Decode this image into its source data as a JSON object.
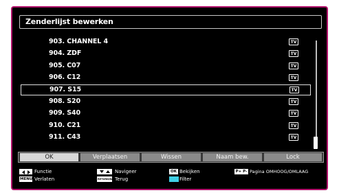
{
  "title": "Zenderlijst bewerken",
  "channels": [
    {
      "name": "903. CHANNEL 4",
      "type": "TV",
      "selected": false
    },
    {
      "name": "904. ZDF",
      "type": "TV",
      "selected": false
    },
    {
      "name": "905. C07",
      "type": "TV",
      "selected": false
    },
    {
      "name": "906. C12",
      "type": "TV",
      "selected": false
    },
    {
      "name": "907. S15",
      "type": "TV",
      "selected": true
    },
    {
      "name": "908. S20",
      "type": "TV",
      "selected": false
    },
    {
      "name": "909. S40",
      "type": "TV",
      "selected": false
    },
    {
      "name": "910. C21",
      "type": "TV",
      "selected": false
    },
    {
      "name": "911. C43",
      "type": "TV",
      "selected": false
    }
  ],
  "buttons": {
    "ok": "OK",
    "move": "Verplaatsen",
    "delete": "Wissen",
    "rename": "Naam bew.",
    "lock": "Lock"
  },
  "help": {
    "function_label": "Functie",
    "menu_key": "MENU",
    "exit_label": "Verlaten",
    "navigate_label": "Navigeer",
    "return_key": "RETURN/BACK",
    "back_label": "Terug",
    "ok_key": "OK",
    "view_label": "Bekijken",
    "filter_label": "Filter",
    "page_keys": "P+ P-",
    "page_label": "Pagina OMHOOG/OMLAAG"
  },
  "colors": {
    "frame_border": "#b0106a",
    "background": "#000000",
    "filter_key": "#3fd0e6",
    "active_button": "#d7d7d7"
  },
  "icons": {
    "left_right": "left-right-arrows-icon",
    "up_down": "up-down-arrows-icon",
    "tv_badge": "tv-badge-icon"
  }
}
